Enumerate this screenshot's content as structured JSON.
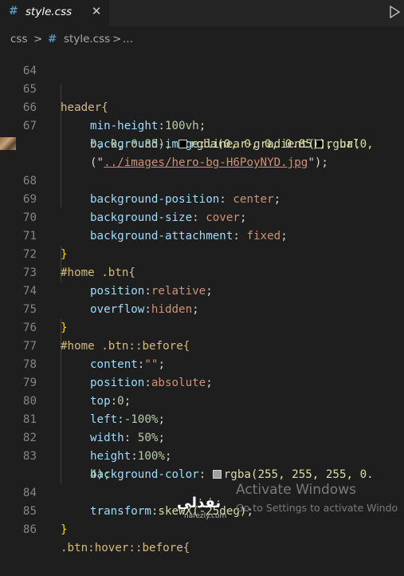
{
  "tab": {
    "icon": "#",
    "label": "style.css",
    "close": "✕"
  },
  "breadcrumb": {
    "folder": "css",
    "sep1": ">",
    "file_icon": "#",
    "file": "style.css",
    "sep2": ">",
    "ellipsis": "..."
  },
  "lines": [
    {
      "n": "64"
    },
    {
      "n": "65",
      "text": "header{"
    },
    {
      "n": "66",
      "prop": "min-height",
      "val": "100vh"
    },
    {
      "n": "67",
      "prop": "background-image",
      "val1": "linear-gradient(",
      "val2": "rgba(0,",
      "wrap1": "0, 0, 0.85),",
      "val3": "rgba(0, 0, 0, 0.85)), url",
      "wrap2a": "(\"",
      "wrap2b": "../images/hero-bg-H6PoyNYD.jpg",
      "wrap2c": "\");"
    },
    {
      "n": "68",
      "prop": "background-position",
      "val": "center"
    },
    {
      "n": "69",
      "prop": "background-size",
      "val": "cover"
    },
    {
      "n": "70",
      "prop": "background-attachment",
      "val": "fixed"
    },
    {
      "n": "71",
      "text": "}"
    },
    {
      "n": "72",
      "text": "#home .btn{"
    },
    {
      "n": "73",
      "prop": "position",
      "val": "relative"
    },
    {
      "n": "74",
      "prop": "overflow",
      "val": "hidden"
    },
    {
      "n": "75",
      "text": "}"
    },
    {
      "n": "76",
      "text": "#home .btn::before{"
    },
    {
      "n": "77",
      "prop": "content",
      "val": "\"\""
    },
    {
      "n": "78",
      "prop": "position",
      "val": "absolute"
    },
    {
      "n": "79",
      "prop": "top",
      "val": "0"
    },
    {
      "n": "80",
      "prop": "left",
      "val": "-100%"
    },
    {
      "n": "81",
      "prop": "width",
      "val": "50%"
    },
    {
      "n": "82",
      "prop": "height",
      "val": "100%"
    },
    {
      "n": "83",
      "prop": "background-color",
      "val": "rgba(255, 255, 255, 0.",
      "wrap": "4);"
    },
    {
      "n": "84",
      "prop": "transform",
      "val": "skewX(-25deg)"
    },
    {
      "n": "85",
      "text": "}"
    },
    {
      "n": "86",
      "text": ".btn:hover::before{"
    }
  ],
  "watermark": {
    "title": "Activate Windows",
    "sub": "Go to Settings to activate Windo"
  },
  "logo": {
    "text": "نفذلي",
    "sub": "nafezly.com"
  },
  "colors": {
    "swatch_dark": "#000000",
    "swatch_white": "#a0a0a0"
  }
}
